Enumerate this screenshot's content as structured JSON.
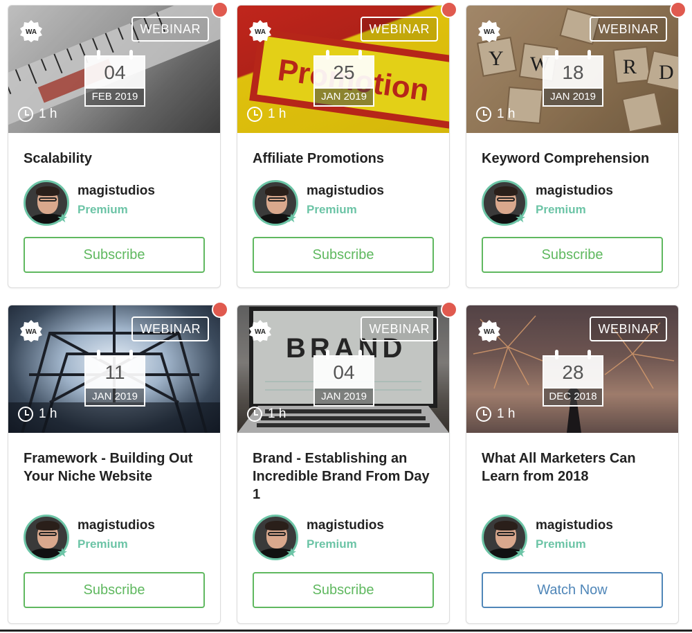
{
  "cards": [
    {
      "tag": "WEBINAR",
      "day": "04",
      "monthyear": "FEB 2019",
      "duration": "1 h",
      "title": "Scalability",
      "author": "magistudios",
      "level": "Premium",
      "button": "Subscribe",
      "logo_icon": "wa-badge-icon",
      "new_indicator": true
    },
    {
      "tag": "WEBINAR",
      "day": "25",
      "monthyear": "JAN 2019",
      "duration": "1 h",
      "title": "Affiliate Promotions",
      "author": "magistudios",
      "level": "Premium",
      "button": "Subscribe",
      "logo_icon": "wa-badge-icon",
      "new_indicator": true
    },
    {
      "tag": "WEBINAR",
      "day": "18",
      "monthyear": "JAN 2019",
      "duration": "1 h",
      "title": "Keyword Comprehension",
      "author": "magistudios",
      "level": "Premium",
      "button": "Subscribe",
      "logo_icon": "wa-badge-icon",
      "new_indicator": true
    },
    {
      "tag": "WEBINAR",
      "day": "11",
      "monthyear": "JAN 2019",
      "duration": "1 h",
      "title": "Framework - Building Out Your Niche Website",
      "author": "magistudios",
      "level": "Premium",
      "button": "Subscribe",
      "logo_icon": "wa-badge-icon",
      "new_indicator": true
    },
    {
      "tag": "WEBINAR",
      "day": "04",
      "monthyear": "JAN 2019",
      "duration": "1 h",
      "title": "Brand - Establishing an Incredible Brand From Day 1",
      "author": "magistudios",
      "level": "Premium",
      "button": "Subscribe",
      "logo_icon": "wa-badge-icon",
      "new_indicator": true
    },
    {
      "tag": "WEBINAR",
      "day": "28",
      "monthyear": "DEC 2018",
      "duration": "1 h",
      "title": "What All Marketers Can Learn from 2018",
      "author": "magistudios",
      "level": "Premium",
      "button": "Watch Now",
      "logo_icon": "wa-badge-icon",
      "new_indicator": false
    }
  ],
  "colors": {
    "accent_green": "#6cc4a6",
    "subscribe_green": "#5fb85f",
    "watch_blue": "#4f86b8",
    "new_dot_red": "#e05a4f"
  }
}
